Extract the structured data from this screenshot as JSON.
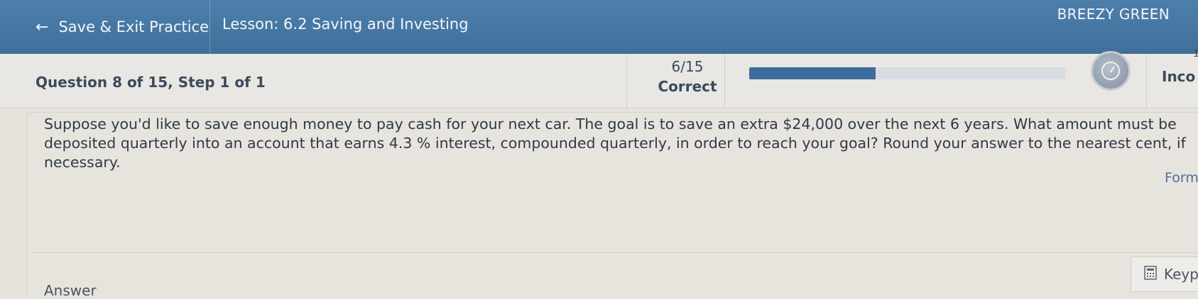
{
  "header": {
    "back_label": "Save & Exit Practice",
    "lesson": "Lesson: 6.2 Saving and Investing",
    "user": "BREEZY GREEN"
  },
  "status": {
    "question_info": "Question 8 of 15, Step 1 of 1",
    "score": "6/15",
    "score_label": "Correct",
    "progress_fraction": 0.4,
    "right_partial_label": "Inco",
    "right_partial_number": "1"
  },
  "question": {
    "text": "Suppose you'd like to save enough money to pay cash for your next car. The goal is to save an extra $24,000 over the next 6 years. What amount must be deposited quarterly into an account that earns 4.3 %  interest, compounded quarterly, in order to reach your goal? Round your answer to the nearest cent, if necessary.",
    "formula_link": "Form"
  },
  "answer": {
    "label": "Answer",
    "keypad_label": "Keyp"
  },
  "colors": {
    "header_bg": "#4576a2",
    "progress_fill": "#3d6c9c",
    "page_bg": "#e6e3dc"
  }
}
